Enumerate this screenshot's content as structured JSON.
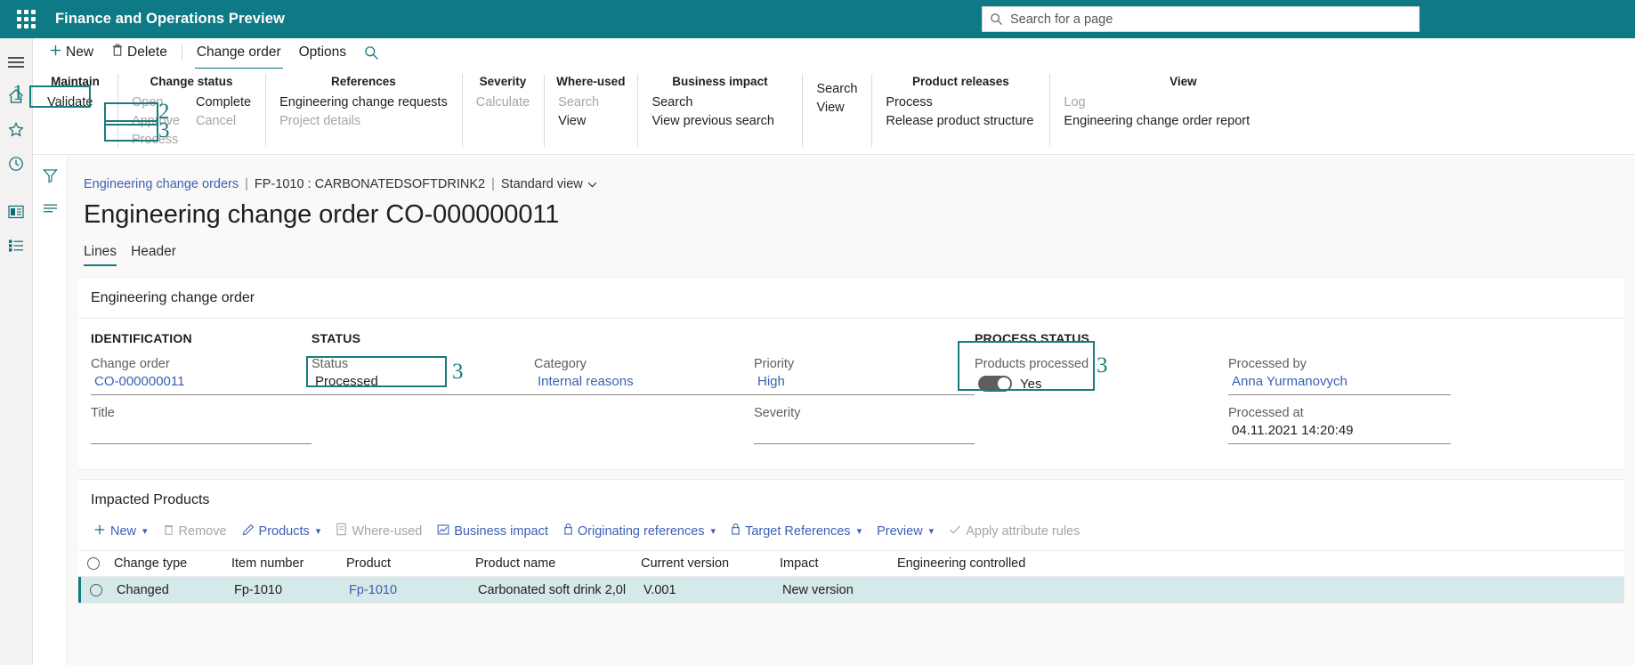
{
  "topbar": {
    "waffle_icon": "app-launcher-icon",
    "app_title": "Finance and Operations Preview",
    "search_icon": "search-icon",
    "search_placeholder": "Search for a page",
    "search_value": ""
  },
  "rail": {
    "items": [
      {
        "name": "hamburger-icon",
        "label": "Menu"
      },
      {
        "name": "home-icon",
        "label": "Home"
      },
      {
        "name": "star-icon",
        "label": "Favorites"
      },
      {
        "name": "clock-icon",
        "label": "Recent"
      },
      {
        "name": "workspaces-icon",
        "label": "Workspaces"
      },
      {
        "name": "modules-icon",
        "label": "Modules"
      }
    ]
  },
  "command_bar": {
    "items": [
      {
        "label": "New",
        "icon": "plus-icon",
        "active": false
      },
      {
        "label": "Delete",
        "icon": "trash-icon",
        "active": false
      },
      {
        "label": "Change order",
        "icon": "",
        "active": true
      },
      {
        "label": "Options",
        "icon": "",
        "active": false
      }
    ],
    "search_icon": "search-icon"
  },
  "ribbon": {
    "groups": [
      {
        "title": "Maintain",
        "columns": [
          {
            "items": [
              {
                "label": "Validate",
                "disabled": false
              }
            ]
          }
        ]
      },
      {
        "title": "Change status",
        "columns": [
          {
            "items": [
              {
                "label": "Open",
                "disabled": true
              },
              {
                "label": "Approve",
                "disabled": true
              },
              {
                "label": "Process",
                "disabled": true
              }
            ]
          },
          {
            "items": [
              {
                "label": "Complete",
                "disabled": false
              },
              {
                "label": "Cancel",
                "disabled": true
              }
            ]
          }
        ]
      },
      {
        "title": "References",
        "columns": [
          {
            "items": [
              {
                "label": "Engineering change requests",
                "disabled": false
              },
              {
                "label": "Project details",
                "disabled": true
              }
            ]
          }
        ]
      },
      {
        "title": "Severity",
        "columns": [
          {
            "items": [
              {
                "label": "Calculate",
                "disabled": true
              }
            ]
          }
        ]
      },
      {
        "title": "Where-used",
        "columns": [
          {
            "items": [
              {
                "label": "Search",
                "disabled": true
              },
              {
                "label": "View",
                "disabled": false
              }
            ]
          }
        ]
      },
      {
        "title": "Business impact",
        "columns": [
          {
            "items": [
              {
                "label": "Search",
                "disabled": false
              },
              {
                "label": "View previous search",
                "disabled": false
              }
            ]
          }
        ]
      },
      {
        "title": "",
        "columns": [
          {
            "items": [
              {
                "label": "Search",
                "disabled": false
              },
              {
                "label": "View",
                "disabled": false
              }
            ]
          }
        ]
      },
      {
        "title": "Product releases",
        "columns": [
          {
            "items": [
              {
                "label": "Process",
                "disabled": false
              },
              {
                "label": "Release product structure",
                "disabled": false
              }
            ]
          }
        ]
      },
      {
        "title": "View",
        "columns": [
          {
            "items": [
              {
                "label": "Log",
                "disabled": true
              },
              {
                "label": "Engineering change order report",
                "disabled": false
              }
            ]
          }
        ]
      }
    ],
    "annotations": [
      {
        "marker": "1",
        "target": "Validate"
      },
      {
        "marker": "2",
        "target": "Approve"
      },
      {
        "marker": "3",
        "target": "Process"
      }
    ]
  },
  "breadcrumb": {
    "link": "Engineering change orders",
    "sep1": "|",
    "record": "FP-1010 : CARBONATEDSOFTDRINK2",
    "sep2": "|",
    "view": "Standard view",
    "view_chevron_icon": "chevron-down-icon"
  },
  "page_title": "Engineering change order CO-000000011",
  "tabs": [
    {
      "label": "Lines",
      "selected": true
    },
    {
      "label": "Header",
      "selected": false
    }
  ],
  "eco_card": {
    "title": "Engineering change order",
    "sections": {
      "identification": {
        "label": "IDENTIFICATION",
        "fields": [
          {
            "label": "Change order",
            "value": "CO-000000011",
            "style": "link"
          },
          {
            "label": "Title",
            "value": "",
            "style": "empty"
          }
        ]
      },
      "status": {
        "label": "STATUS",
        "fields": [
          {
            "label": "Status",
            "value": "Processed",
            "style": "plain",
            "highlight": true,
            "marker": "3"
          }
        ]
      },
      "category": {
        "label": "",
        "fields": [
          {
            "label": "Category",
            "value": "Internal reasons",
            "style": "link"
          }
        ]
      },
      "priority": {
        "label": "",
        "fields": [
          {
            "label": "Priority",
            "value": "High",
            "style": "link"
          },
          {
            "label": "Severity",
            "value": "",
            "style": "empty"
          }
        ]
      },
      "process_status": {
        "label": "PROCESS STATUS",
        "toggle_label": "Products processed",
        "toggle_value": "Yes",
        "toggle_on": true,
        "marker": "3"
      },
      "processed": {
        "label": "",
        "fields": [
          {
            "label": "Processed by",
            "value": "Anna Yurmanovych",
            "style": "link"
          },
          {
            "label": "Processed at",
            "value": "04.11.2021 14:20:49",
            "style": "plain"
          }
        ]
      }
    }
  },
  "impacted_products": {
    "title": "Impacted Products",
    "toolbar": [
      {
        "label": "New",
        "icon": "plus-icon",
        "chevron": true,
        "disabled": false
      },
      {
        "label": "Remove",
        "icon": "trash-icon",
        "chevron": false,
        "disabled": true
      },
      {
        "label": "Products",
        "icon": "pencil-icon",
        "chevron": true,
        "disabled": false
      },
      {
        "label": "Where-used",
        "icon": "document-icon",
        "chevron": false,
        "disabled": true
      },
      {
        "label": "Business impact",
        "icon": "chart-icon",
        "chevron": false,
        "disabled": false
      },
      {
        "label": "Originating references",
        "icon": "link-icon",
        "chevron": true,
        "disabled": false
      },
      {
        "label": "Target References",
        "icon": "link-icon",
        "chevron": true,
        "disabled": false
      },
      {
        "label": "Preview",
        "icon": "",
        "chevron": true,
        "disabled": false
      },
      {
        "label": "Apply attribute rules",
        "icon": "check-icon",
        "chevron": false,
        "disabled": true
      }
    ],
    "columns": [
      "Change type",
      "Item number",
      "Product",
      "Product name",
      "Current version",
      "Impact",
      "Engineering controlled"
    ],
    "rows": [
      {
        "selected": true,
        "change_type": "Changed",
        "item_number": "Fp-1010",
        "product": "Fp-1010",
        "product_name": "Carbonated soft drink 2,0l",
        "current_version": "V.001",
        "impact": "New version",
        "engineering_controlled": ""
      }
    ]
  },
  "colors": {
    "brand_teal": "#0e7a85",
    "highlight_border": "#1a7b7f",
    "link_blue": "#3b60b5",
    "row_selected": "#d5e8ea"
  }
}
